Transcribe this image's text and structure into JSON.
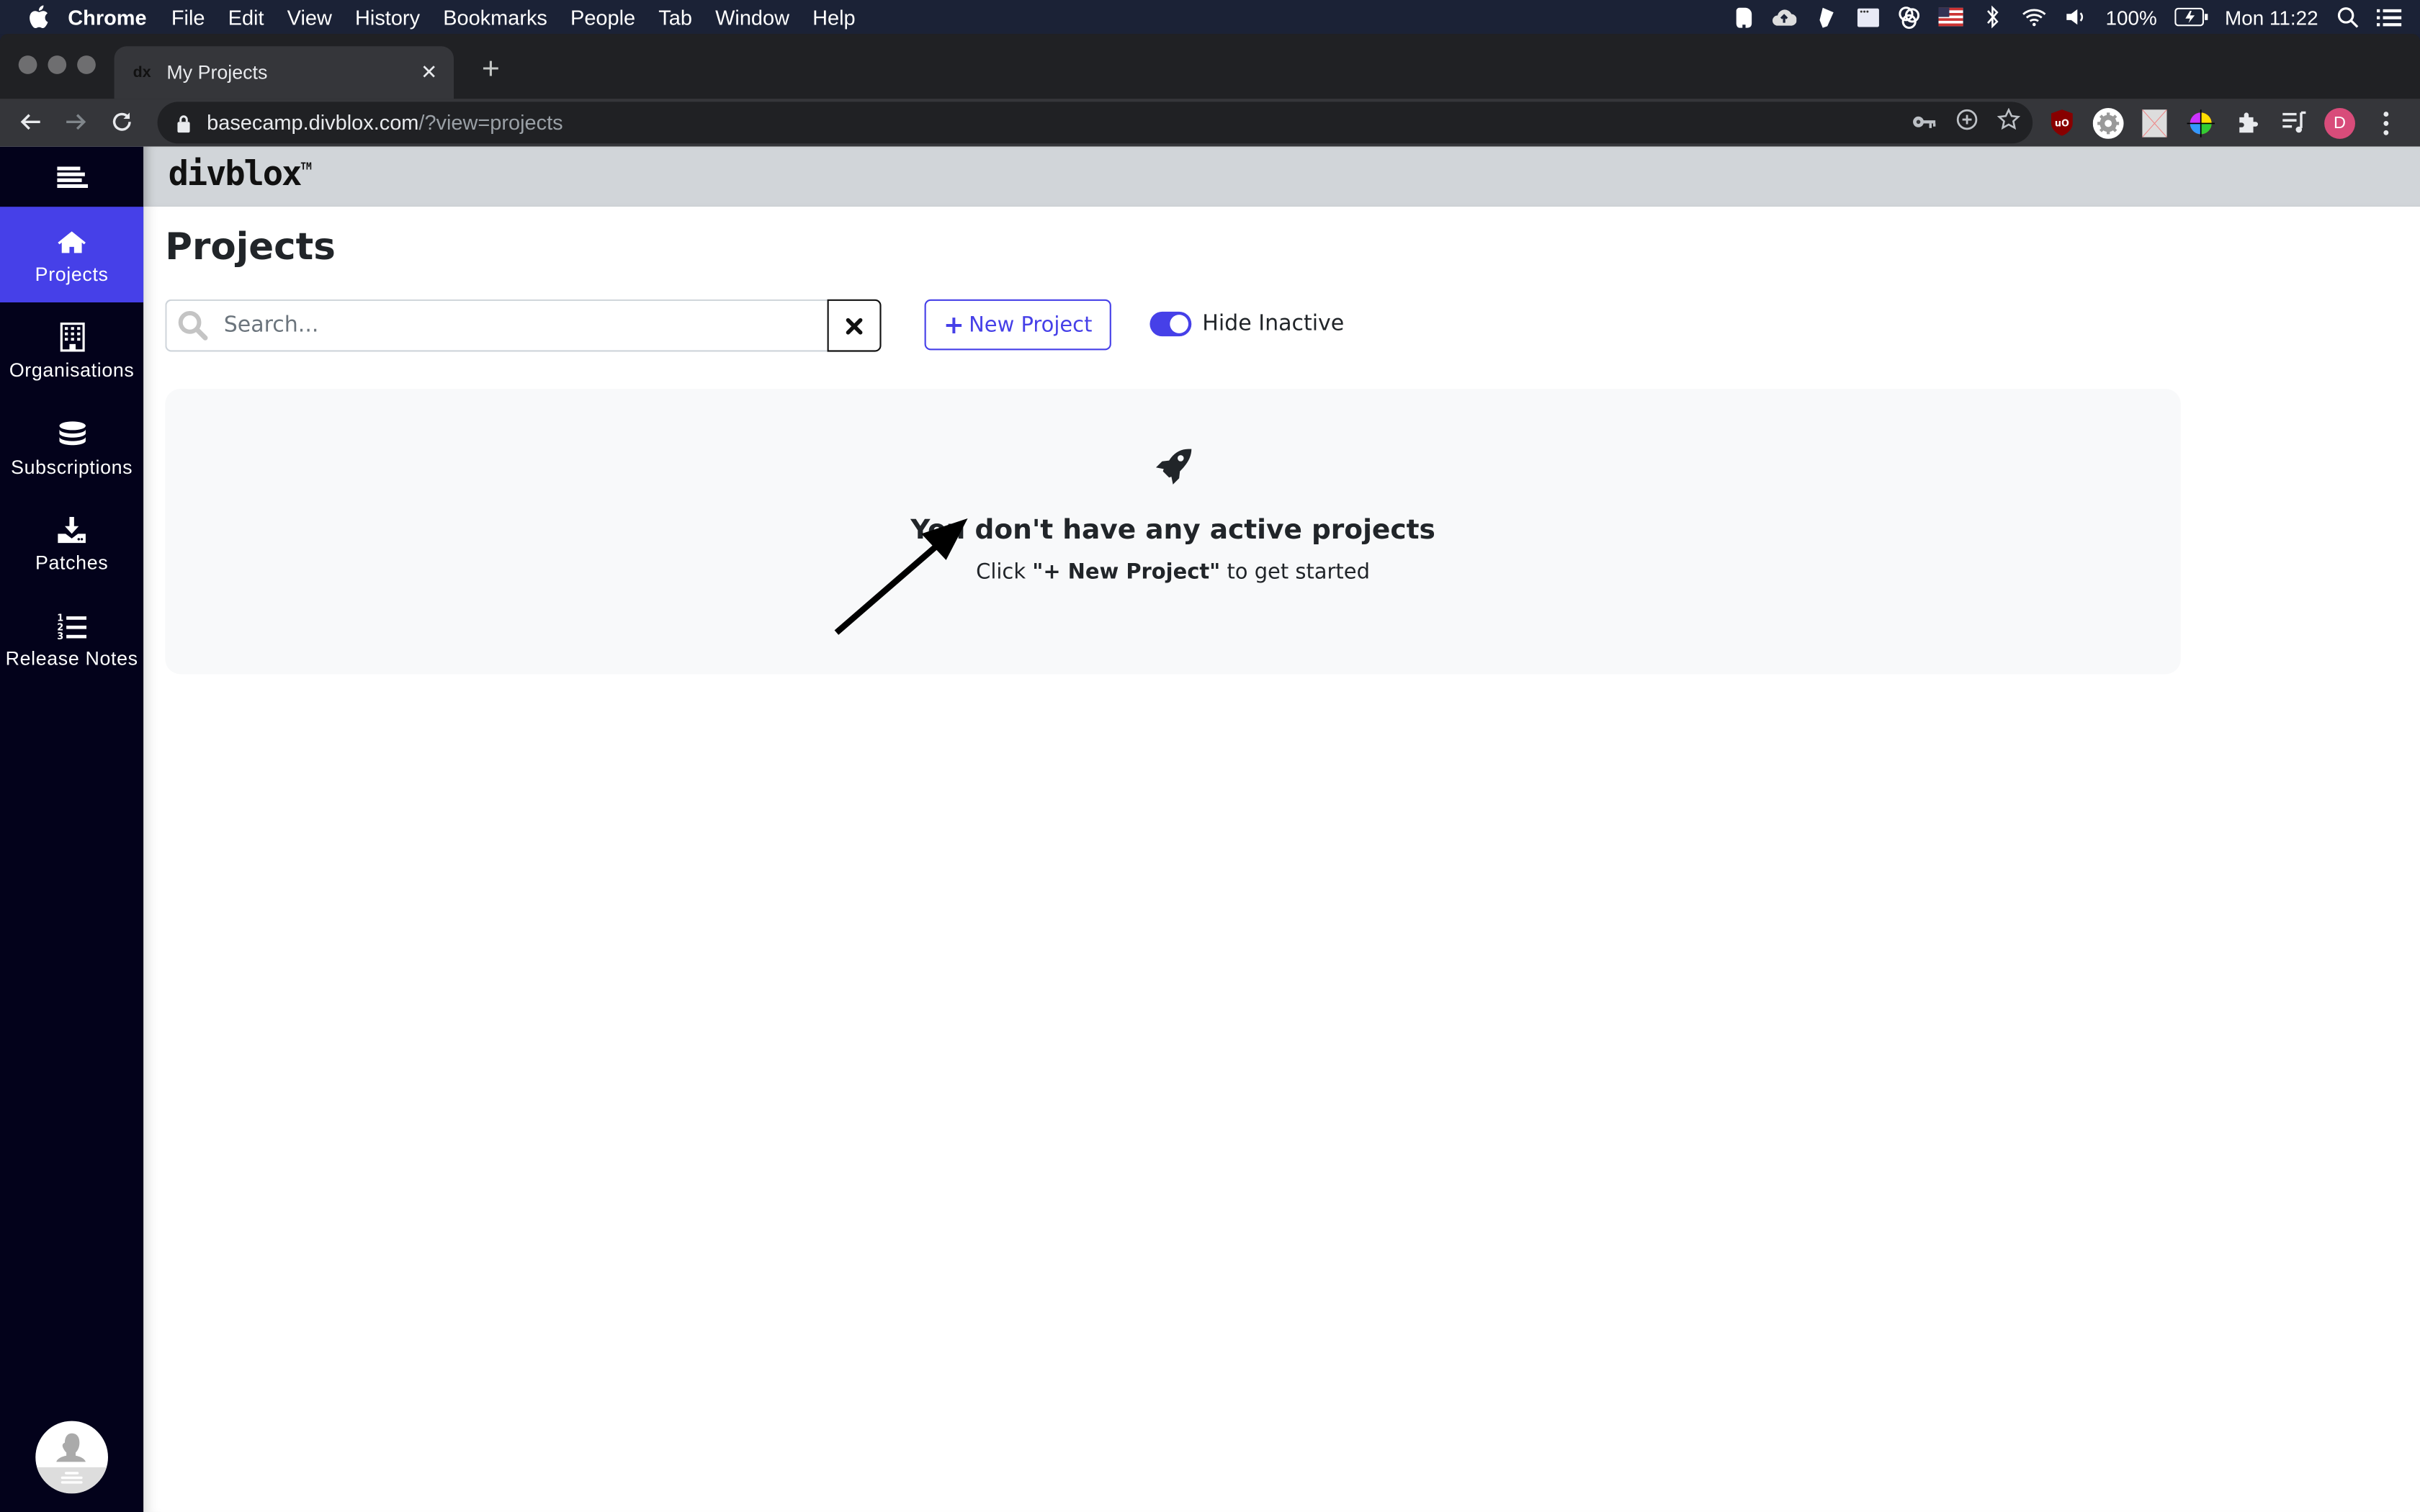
{
  "menubar": {
    "app_name": "Chrome",
    "menus": [
      "File",
      "Edit",
      "View",
      "History",
      "Bookmarks",
      "People",
      "Tab",
      "Window",
      "Help"
    ],
    "status_icons": [
      "evernote-icon",
      "cloud-upload-icon",
      "pen-icon",
      "window-icon",
      "creative-cloud-icon",
      "us-flag-icon",
      "bluetooth-icon",
      "wifi-icon",
      "volume-icon"
    ],
    "battery": "100%",
    "clock": "Mon 11:22"
  },
  "browser": {
    "tab_title": "My Projects",
    "tab_favicon": "dx",
    "url_host": "basecamp.divblox.com",
    "url_path": "/?view=projects",
    "profile_initial": "D"
  },
  "app": {
    "logo_text": "divblox",
    "logo_tm": "TM",
    "sidebar": {
      "items": [
        {
          "label": "Projects",
          "icon": "home-icon",
          "active": true
        },
        {
          "label": "Organisations",
          "icon": "building-icon",
          "active": false
        },
        {
          "label": "Subscriptions",
          "icon": "database-icon",
          "active": false
        },
        {
          "label": "Patches",
          "icon": "download-icon",
          "active": false
        },
        {
          "label": "Release Notes",
          "icon": "numbered-list-icon",
          "active": false
        }
      ]
    },
    "page_title": "Projects",
    "search": {
      "placeholder": "Search...",
      "value": ""
    },
    "new_project_button": {
      "icon": "+",
      "label": "New Project"
    },
    "hide_inactive": {
      "label": "Hide Inactive",
      "checked": true
    },
    "empty_state": {
      "title": "You don't have any active projects",
      "sub_prefix": "Click ",
      "sub_bold": "\"+ New Project\"",
      "sub_suffix": " to get started"
    }
  },
  "colors": {
    "accent": "#4640e8",
    "sidebar_bg": "#03021b",
    "topbar_bg": "#d1d5d9",
    "panel_bg": "#f8f9fa",
    "profile": "#d84c7a"
  }
}
